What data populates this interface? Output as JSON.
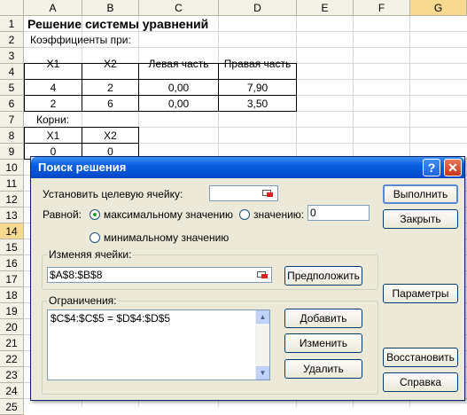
{
  "columns": [
    "A",
    "B",
    "C",
    "D",
    "E",
    "F",
    "G"
  ],
  "rows": [
    "1",
    "2",
    "3",
    "4",
    "5",
    "6",
    "7",
    "8",
    "9",
    "10",
    "11",
    "12",
    "13",
    "14",
    "15",
    "16",
    "17",
    "18",
    "19",
    "20",
    "21",
    "22",
    "23",
    "24",
    "25"
  ],
  "sheet": {
    "title": "Решение системы уравнений",
    "coef_label": "Коэффициенты при:",
    "headers": [
      "X1",
      "X2",
      "Левая часть",
      "Правая часть"
    ],
    "row4": [
      "4",
      "2",
      "0,00",
      "7,90"
    ],
    "row5": [
      "2",
      "6",
      "0,00",
      "3,50"
    ],
    "roots_label": "Корни:",
    "roots_headers": [
      "X1",
      "X2"
    ],
    "roots_values": [
      "0",
      "0"
    ]
  },
  "dialog": {
    "title": "Поиск решения",
    "help_glyph": "?",
    "close_glyph": "✕",
    "target_label": "Установить целевую ячейку:",
    "target_value": "",
    "equal_label": "Равной:",
    "opt_max": "максимальному значению",
    "opt_value": "значению:",
    "value_field": "0",
    "opt_min": "минимальному значению",
    "changing_label": "Изменяя ячейки:",
    "changing_value": "$A$8:$B$8",
    "constraints_label": "Ограничения:",
    "constraints": [
      "$C$4:$C$5 = $D$4:$D$5"
    ],
    "buttons": {
      "run": "Выполнить",
      "close": "Закрыть",
      "guess": "Предположить",
      "params": "Параметры",
      "add": "Добавить",
      "change": "Изменить",
      "delete": "Удалить",
      "restore": "Восстановить",
      "help": "Справка"
    }
  }
}
